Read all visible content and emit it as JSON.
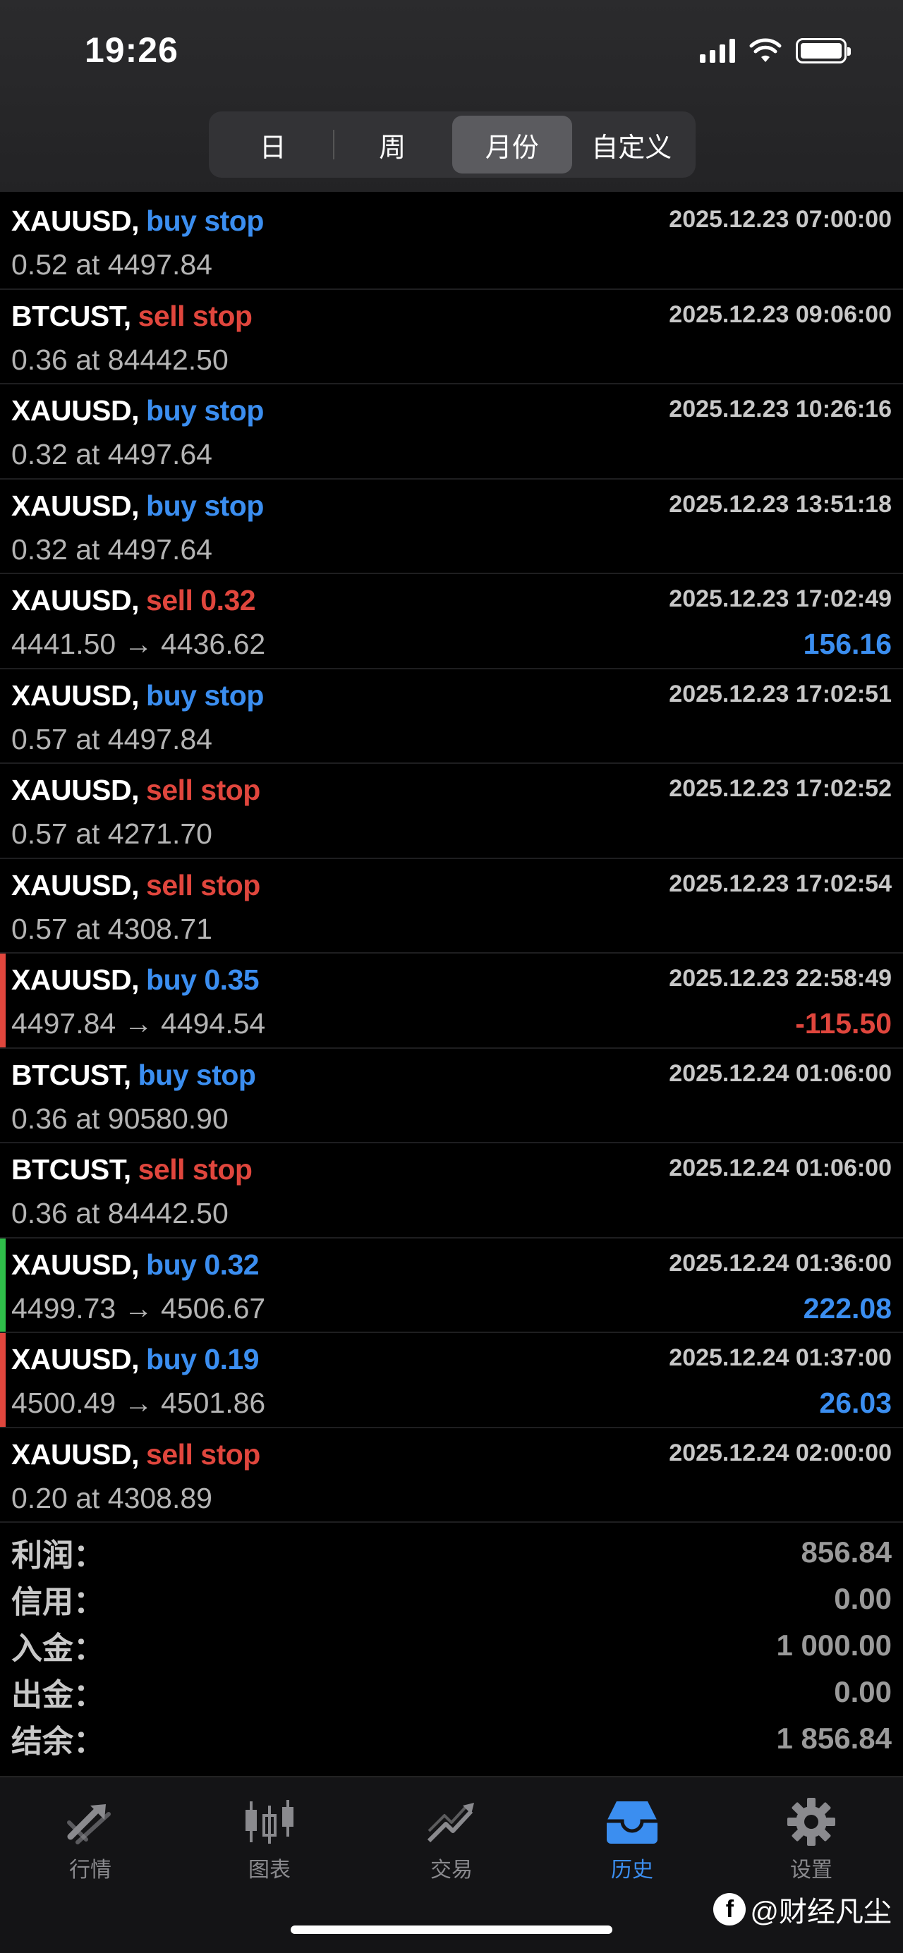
{
  "status_bar": {
    "time": "19:26"
  },
  "period_tabs": [
    {
      "label": "日",
      "active": false
    },
    {
      "label": "周",
      "active": false
    },
    {
      "label": "月份",
      "active": true
    },
    {
      "label": "自定义",
      "active": false
    }
  ],
  "colors": {
    "buy": "#3b8ef0",
    "sell": "#e0463d",
    "mark_green": "#2fbf4a",
    "mark_red": "#e0463d"
  },
  "rows": [
    {
      "symbol": "XAUUSD,",
      "side": "buy stop",
      "side_color": "blue",
      "time": "2025.12.23 07:00:00",
      "detail": "0.52 at 4497.84",
      "profit": "",
      "profit_color": "",
      "mark": ""
    },
    {
      "symbol": "BTCUST,",
      "side": "sell stop",
      "side_color": "red",
      "time": "2025.12.23 09:06:00",
      "detail": "0.36 at 84442.50",
      "profit": "",
      "profit_color": "",
      "mark": ""
    },
    {
      "symbol": "XAUUSD,",
      "side": "buy stop",
      "side_color": "blue",
      "time": "2025.12.23 10:26:16",
      "detail": "0.32 at 4497.64",
      "profit": "",
      "profit_color": "",
      "mark": ""
    },
    {
      "symbol": "XAUUSD,",
      "side": "buy stop",
      "side_color": "blue",
      "time": "2025.12.23 13:51:18",
      "detail": "0.32 at 4497.64",
      "profit": "",
      "profit_color": "",
      "mark": ""
    },
    {
      "symbol": "XAUUSD,",
      "side": "sell 0.32",
      "side_color": "red",
      "time": "2025.12.23 17:02:49",
      "detail": "4441.50 → 4436.62",
      "profit": "156.16",
      "profit_color": "blue",
      "mark": ""
    },
    {
      "symbol": "XAUUSD,",
      "side": "buy stop",
      "side_color": "blue",
      "time": "2025.12.23 17:02:51",
      "detail": "0.57 at 4497.84",
      "profit": "",
      "profit_color": "",
      "mark": ""
    },
    {
      "symbol": "XAUUSD,",
      "side": "sell stop",
      "side_color": "red",
      "time": "2025.12.23 17:02:52",
      "detail": "0.57 at 4271.70",
      "profit": "",
      "profit_color": "",
      "mark": ""
    },
    {
      "symbol": "XAUUSD,",
      "side": "sell stop",
      "side_color": "red",
      "time": "2025.12.23 17:02:54",
      "detail": "0.57 at 4308.71",
      "profit": "",
      "profit_color": "",
      "mark": ""
    },
    {
      "symbol": "XAUUSD,",
      "side": "buy 0.35",
      "side_color": "blue",
      "time": "2025.12.23 22:58:49",
      "detail": "4497.84 → 4494.54",
      "profit": "-115.50",
      "profit_color": "red",
      "mark": "red"
    },
    {
      "symbol": "BTCUST,",
      "side": "buy stop",
      "side_color": "blue",
      "time": "2025.12.24 01:06:00",
      "detail": "0.36 at 90580.90",
      "profit": "",
      "profit_color": "",
      "mark": ""
    },
    {
      "symbol": "BTCUST,",
      "side": "sell stop",
      "side_color": "red",
      "time": "2025.12.24 01:06:00",
      "detail": "0.36 at 84442.50",
      "profit": "",
      "profit_color": "",
      "mark": ""
    },
    {
      "symbol": "XAUUSD,",
      "side": "buy 0.32",
      "side_color": "blue",
      "time": "2025.12.24 01:36:00",
      "detail": "4499.73 → 4506.67",
      "profit": "222.08",
      "profit_color": "blue",
      "mark": "green"
    },
    {
      "symbol": "XAUUSD,",
      "side": "buy 0.19",
      "side_color": "blue",
      "time": "2025.12.24 01:37:00",
      "detail": "4500.49 → 4501.86",
      "profit": "26.03",
      "profit_color": "blue",
      "mark": "red"
    },
    {
      "symbol": "XAUUSD,",
      "side": "sell stop",
      "side_color": "red",
      "time": "2025.12.24 02:00:00",
      "detail": "0.20 at 4308.89",
      "profit": "",
      "profit_color": "",
      "mark": ""
    }
  ],
  "summary": [
    {
      "label": "利润：",
      "value": "856.84"
    },
    {
      "label": "信用：",
      "value": "0.00"
    },
    {
      "label": "入金：",
      "value": "1 000.00"
    },
    {
      "label": "出金：",
      "value": "0.00"
    },
    {
      "label": "结余：",
      "value": "1 856.84"
    }
  ],
  "tabbar": [
    {
      "label": "行情",
      "icon": "quotes-icon",
      "active": false
    },
    {
      "label": "图表",
      "icon": "chart-icon",
      "active": false
    },
    {
      "label": "交易",
      "icon": "trade-icon",
      "active": false
    },
    {
      "label": "历史",
      "icon": "history-icon",
      "active": true
    },
    {
      "label": "设置",
      "icon": "settings-icon",
      "active": false
    }
  ],
  "watermark": {
    "logo": "f",
    "text": "@财经凡尘"
  }
}
